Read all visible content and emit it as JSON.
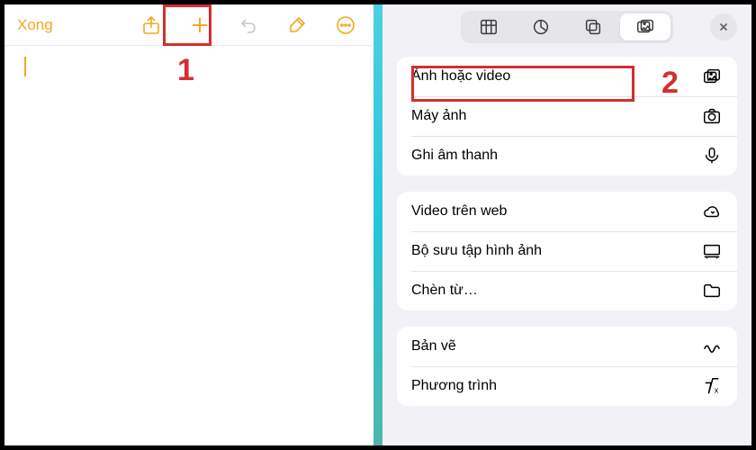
{
  "left": {
    "done_label": "Xong"
  },
  "annotations": {
    "num1": "1",
    "num2": "2"
  },
  "right": {
    "groups": [
      {
        "rows": [
          {
            "label": "Ảnh hoặc video",
            "icon": "photo-stack-icon"
          },
          {
            "label": "Máy ảnh",
            "icon": "camera-icon"
          },
          {
            "label": "Ghi âm thanh",
            "icon": "mic-icon"
          }
        ]
      },
      {
        "rows": [
          {
            "label": "Video trên web",
            "icon": "cloud-icon"
          },
          {
            "label": "Bộ sưu tập hình ảnh",
            "icon": "gallery-icon"
          },
          {
            "label": "Chèn từ…",
            "icon": "folder-icon"
          }
        ]
      },
      {
        "rows": [
          {
            "label": "Bản vẽ",
            "icon": "scribble-icon"
          },
          {
            "label": "Phương trình",
            "icon": "equation-icon"
          }
        ]
      }
    ]
  }
}
